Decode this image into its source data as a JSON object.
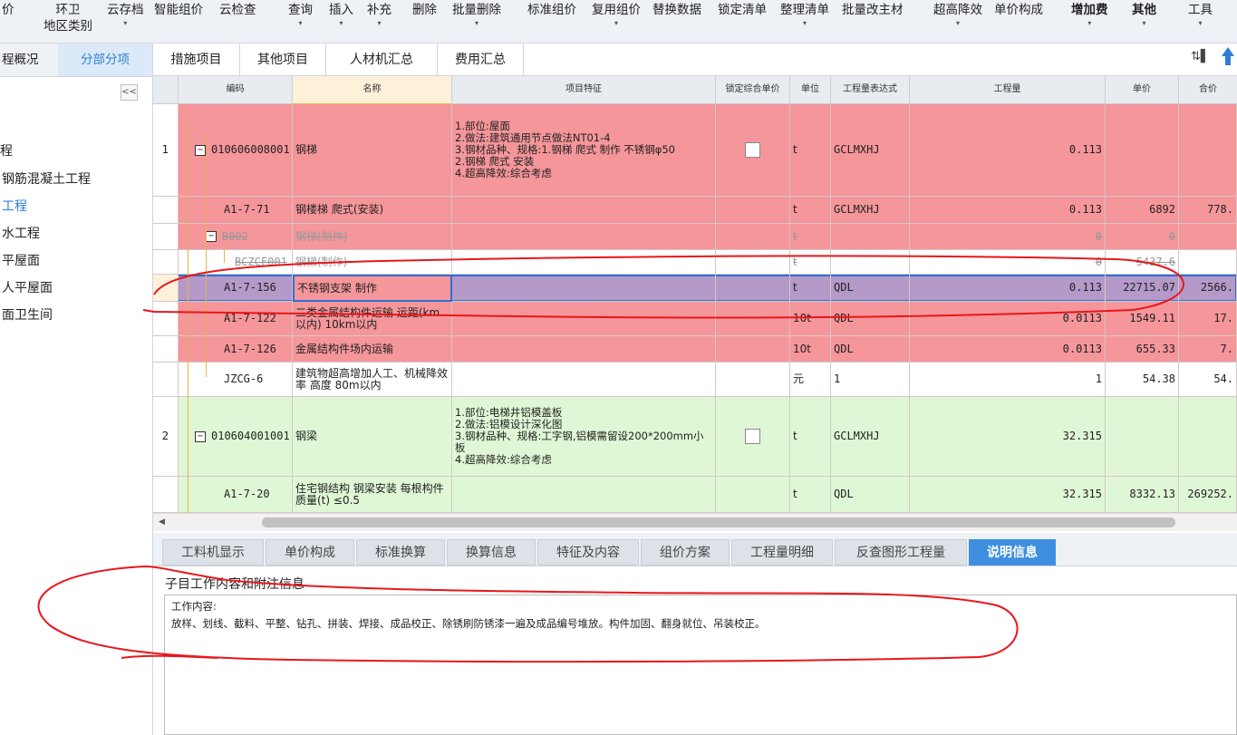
{
  "toolbar": {
    "items": [
      {
        "label": "价"
      },
      {
        "label": "环卫",
        "sub": "地区类别"
      },
      {
        "label": "云存档",
        "arrow": "▾"
      },
      {
        "label": "智能组价"
      },
      {
        "label": "云检查"
      },
      {
        "label": "查询",
        "arrow": "▾"
      },
      {
        "label": "插入",
        "arrow": "▾"
      },
      {
        "label": "补充",
        "arrow": "▾"
      },
      {
        "label": "删除"
      },
      {
        "label": "批量删除",
        "arrow": "▾"
      },
      {
        "label": "标准组价"
      },
      {
        "label": "复用组价",
        "arrow": "▾"
      },
      {
        "label": "替换数据"
      },
      {
        "label": "锁定清单"
      },
      {
        "label": "整理清单",
        "arrow": "▾"
      },
      {
        "label": "批量改主材"
      },
      {
        "label": "超高降效",
        "arrow": "▾"
      },
      {
        "label": "单价构成"
      },
      {
        "label": "增加费",
        "arrow": "▾"
      },
      {
        "label": "其他",
        "arrow": "▾"
      },
      {
        "label": "工具",
        "arrow": "▾"
      }
    ]
  },
  "left": {
    "tabs": [
      "程概况",
      "分部分项"
    ],
    "collapse_glyph": "<<",
    "tree": [
      "程",
      "钢筋混凝土工程",
      "工程",
      "水工程",
      "平屋面",
      "人平屋面",
      "面卫生间"
    ]
  },
  "main_tabs": [
    "措施项目",
    "其他项目",
    "人材机汇总",
    "费用汇总"
  ],
  "grid": {
    "headers": [
      "",
      "编码",
      "名称",
      "项目特征",
      "锁定综合单价",
      "单位",
      "工程量表达式",
      "工程量",
      "单价",
      "合价"
    ],
    "rows": [
      {
        "no": "1",
        "code": "010606008001",
        "name": "钢梯",
        "feature": "1.部位:屋面\n2.做法:建筑通用节点做法NT01-4\n3.钢材品种、规格:1.钢梯 爬式 制作 不锈钢φ50\n2.钢梯 爬式 安装\n4.超高降效:综合考虑",
        "unit": "t",
        "expr": "GCLMXHJ",
        "qty": "0.113",
        "price": "",
        "total": ""
      },
      {
        "no": "",
        "code": "A1-7-71",
        "name": "钢楼梯 爬式(安装)",
        "feature": "",
        "unit": "t",
        "expr": "GCLMXHJ",
        "qty": "0.113",
        "price": "6892",
        "total": "778."
      },
      {
        "no": "",
        "code": "B002",
        "name": "钢梯(制作)",
        "feature": "",
        "unit": "t",
        "expr": "",
        "qty": "0",
        "price": "0",
        "total": ""
      },
      {
        "no": "",
        "code": "BCZCF001",
        "name": "钢梯(制作)",
        "feature": "",
        "unit": "t",
        "expr": "",
        "qty": "0",
        "price": "5437.6",
        "total": ""
      },
      {
        "no": "",
        "code": "A1-7-156",
        "name": "不锈钢支架 制作",
        "feature": "",
        "unit": "t",
        "expr": "QDL",
        "qty": "0.113",
        "price": "22715.07",
        "total": "2566."
      },
      {
        "no": "",
        "code": "A1-7-122",
        "name": "二类金属结构件运输 运距(km以内) 10km以内",
        "feature": "",
        "unit": "10t",
        "expr": "QDL",
        "qty": "0.0113",
        "price": "1549.11",
        "total": "17."
      },
      {
        "no": "",
        "code": "A1-7-126",
        "name": "金属结构件场内运输",
        "feature": "",
        "unit": "10t",
        "expr": "QDL",
        "qty": "0.0113",
        "price": "655.33",
        "total": "7."
      },
      {
        "no": "",
        "code": "JZCG-6",
        "name": "建筑物超高增加人工、机械降效率 高度 80m以内",
        "feature": "",
        "unit": "元",
        "expr": "1",
        "qty": "1",
        "price": "54.38",
        "total": "54."
      },
      {
        "no": "2",
        "code": "010604001001",
        "name": "钢梁",
        "feature": "1.部位:电梯井铝模盖板\n2.做法:铝模设计深化图\n3.钢材品种、规格:工字钢,铝模需留设200*200mm小板\n4.超高降效:综合考虑",
        "unit": "t",
        "expr": "GCLMXHJ",
        "qty": "32.315",
        "price": "",
        "total": ""
      },
      {
        "no": "",
        "code": "A1-7-20",
        "name": "住宅钢结构 钢梁安装 每根构件质量(t) ≤0.5",
        "feature": "",
        "unit": "t",
        "expr": "QDL",
        "qty": "32.315",
        "price": "8332.13",
        "total": "269252."
      }
    ]
  },
  "bottom_tabs": [
    "工料机显示",
    "单价构成",
    "标准换算",
    "换算信息",
    "特征及内容",
    "组价方案",
    "工程量明细",
    "反查图形工程量",
    "说明信息"
  ],
  "bottom_active": "说明信息",
  "bottom_title": "子目工作内容和附注信息",
  "description": {
    "line1": "工作内容:",
    "line2": "放样、划线、截料、平整、钻孔、拼装、焊接、成品校正、除锈刷防锈漆一遍及成品编号堆放。构件加固、翻身就位、吊装校正。"
  },
  "colors": {
    "red_row": "#f5969a",
    "green_row": "#e0f7d6",
    "selected_row": "#b499c9",
    "accent": "#3f8fe0",
    "annotation": "#e8161b"
  }
}
